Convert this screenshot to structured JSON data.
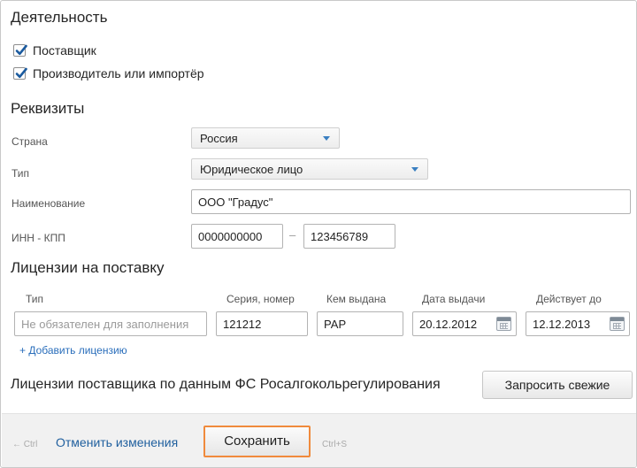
{
  "activity": {
    "title": "Деятельность",
    "options": [
      {
        "label": "Поставщик",
        "checked": true
      },
      {
        "label": "Производитель или импортёр",
        "checked": true
      }
    ]
  },
  "requisites": {
    "title": "Реквизиты",
    "country": {
      "label": "Страна",
      "value": "Россия"
    },
    "type": {
      "label": "Тип",
      "value": "Юридическое лицо"
    },
    "name": {
      "label": "Наименование",
      "value": "ООО \"Градус\""
    },
    "inn_kpp": {
      "label": "ИНН - КПП",
      "inn": "0000000000",
      "separator": "–",
      "kpp": "123456789"
    }
  },
  "licenses": {
    "title": "Лицензии на поставку",
    "columns": [
      "Тип",
      "Серия, номер",
      "Кем выдана",
      "Дата выдачи",
      "Действует до"
    ],
    "row": {
      "type_placeholder": "Не обязателен для заполнения",
      "series": "121212",
      "issuer": "РАР",
      "issue_date": "20.12.2012",
      "valid_until": "12.12.2013"
    },
    "add_link": "+ Добавить лицензию"
  },
  "fs_licenses": {
    "title": "Лицензии поставщика по данным ФС Росалгокольрегулирования",
    "button": "Запросить свежие"
  },
  "footer": {
    "back_hint": "← Ctrl",
    "cancel_label": "Отменить изменения",
    "save_label": "Сохранить",
    "save_hint": "Ctrl+S"
  },
  "colors": {
    "accent": "#2a6ebb",
    "save_border": "#f08a3c",
    "checkbox_check": "#1a5a9e"
  },
  "icons": {
    "checkbox": "check-icon",
    "select": "chevron-down-icon",
    "date": "calendar-icon"
  }
}
